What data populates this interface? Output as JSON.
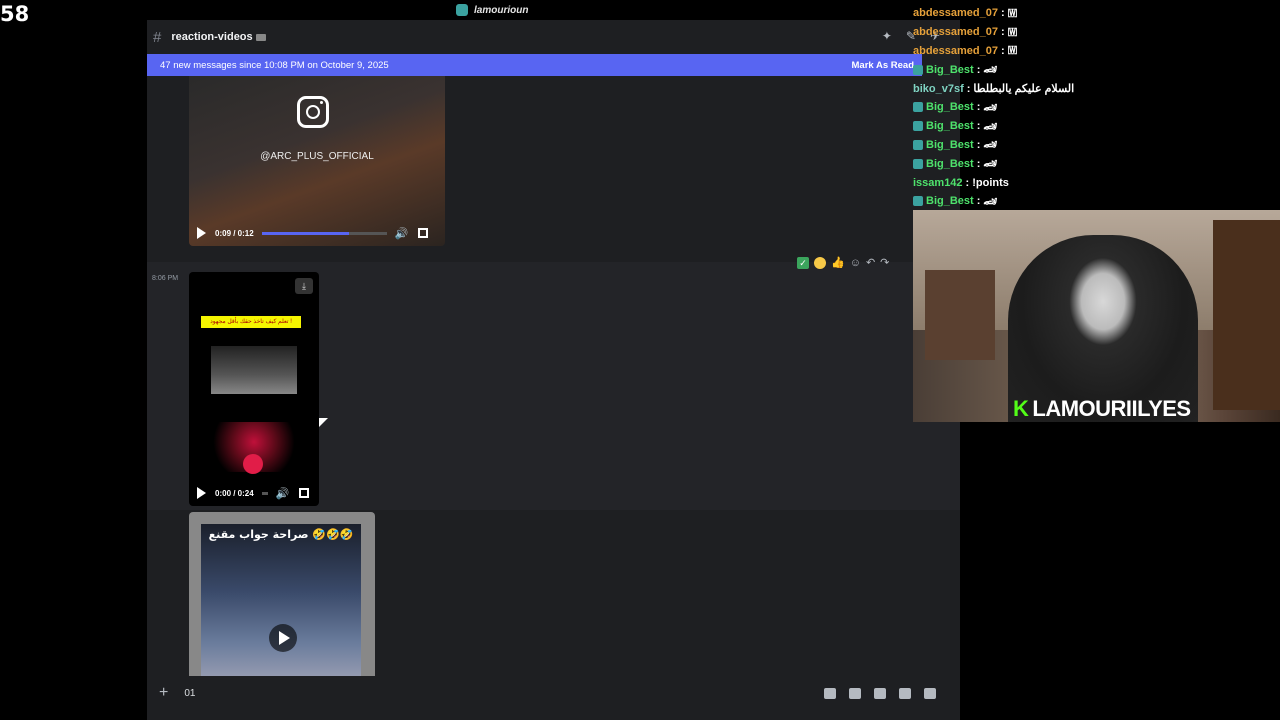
{
  "overlay": {
    "counter": "58"
  },
  "window": {
    "title": "lamourioun"
  },
  "channel": {
    "name": "reaction-videos"
  },
  "banner": {
    "text": "47 new messages since 10:08 PM on October 9, 2025",
    "action": "Mark As Read"
  },
  "messages": {
    "video1": {
      "handle": "@ARC_PLUS_OFFICIAL",
      "time": "0:09 / 0:12",
      "progress": 0.7
    },
    "timestamp": "8:06 PM",
    "video2": {
      "caption": "تعلم كيف تاخذ حقك بأقل مجهود !",
      "time": "0:00 / 0:24",
      "progress": 0.0
    },
    "video3": {
      "caption": "صراحة جواب مقنع 🤣🤣🤣"
    }
  },
  "composer": {
    "text": "01"
  },
  "chat": [
    {
      "user": "abdessamed_07",
      "msg": "🇼",
      "color": "#e6a13a",
      "badge": false
    },
    {
      "user": "abdessamed_07",
      "msg": "🇼",
      "color": "#e6a13a",
      "badge": false
    },
    {
      "user": "abdessamed_07",
      "msg": "🇼",
      "color": "#e6a13a",
      "badge": false
    },
    {
      "user": "Big_Best",
      "msg": "🏎",
      "color": "#4ee26c",
      "badge": true
    },
    {
      "user": "biko_v7sf",
      "msg": "السلام عليكم يالبطلطا",
      "color": "#7fd3c2",
      "badge": false
    },
    {
      "user": "Big_Best",
      "msg": "🏎",
      "color": "#4ee26c",
      "badge": true
    },
    {
      "user": "Big_Best",
      "msg": "🏎",
      "color": "#4ee26c",
      "badge": true
    },
    {
      "user": "Big_Best",
      "msg": "🏎",
      "color": "#4ee26c",
      "badge": true
    },
    {
      "user": "Big_Best",
      "msg": "🏎",
      "color": "#4ee26c",
      "badge": true
    },
    {
      "user": "issam142",
      "msg": "!points",
      "color": "#4ee26c",
      "badge": false
    },
    {
      "user": "Big_Best",
      "msg": "🏎",
      "color": "#4ee26c",
      "badge": true
    }
  ],
  "webcam": {
    "streamer": "LAMOURIILYES"
  }
}
